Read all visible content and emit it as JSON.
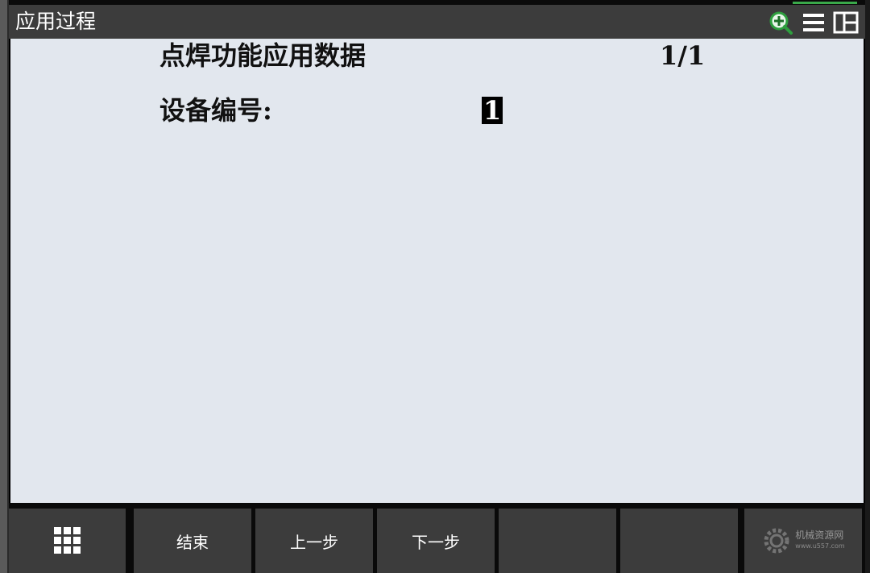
{
  "app": {
    "title": "应用过程"
  },
  "toolbar_icons": [
    "zoom-in-icon",
    "menu-icon",
    "split-view-icon"
  ],
  "colors": {
    "accent": "#3aa94a",
    "titlebar_bg": "#3c3c3c",
    "content_bg": "#e2e7ee",
    "softkey_bg": "#3c3c3c",
    "value_highlight": "#000000"
  },
  "content": {
    "page_title": "点焊功能应用数据",
    "page_number": "1/1",
    "field_label": "设备编号:",
    "field_value": "1"
  },
  "softkeys": {
    "menu_icon": "grid-menu-icon",
    "end": "结束",
    "prev": "上一步",
    "next": "下一步"
  },
  "watermark": {
    "name": "机械资源网",
    "url": "www.u557.com"
  }
}
